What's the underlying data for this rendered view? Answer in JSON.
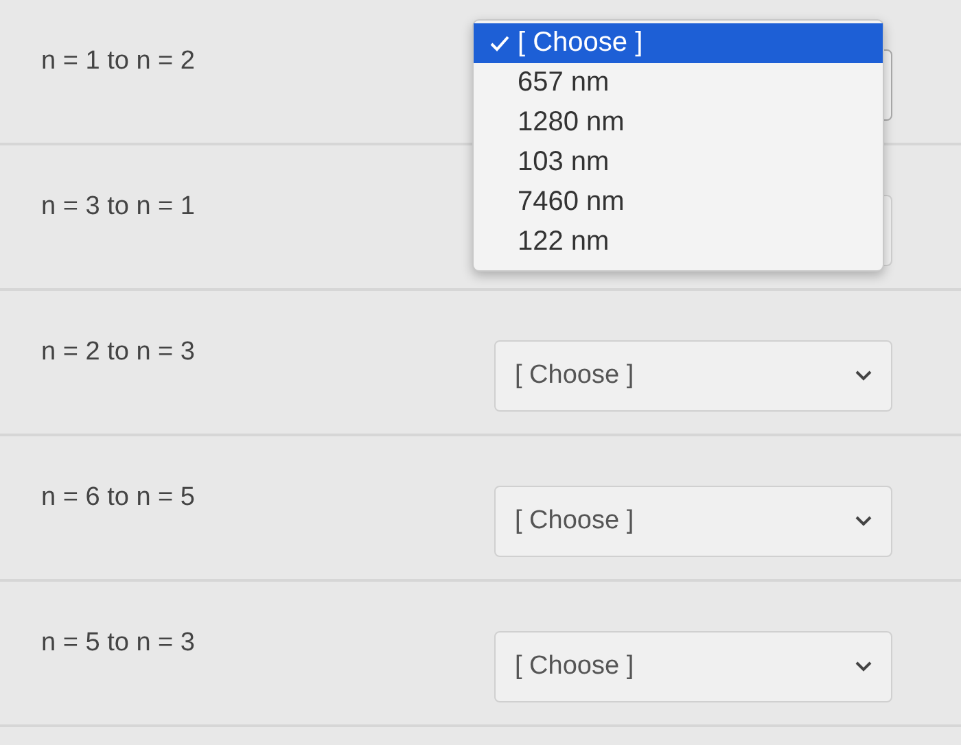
{
  "rows": [
    {
      "label": "n = 1 to n = 2",
      "select": {
        "open": true,
        "options": [
          {
            "label": "[ Choose ]",
            "selected": true
          },
          {
            "label": "657 nm",
            "selected": false
          },
          {
            "label": "1280 nm",
            "selected": false
          },
          {
            "label": "103 nm",
            "selected": false
          },
          {
            "label": "7460 nm",
            "selected": false
          },
          {
            "label": "122 nm",
            "selected": false
          }
        ]
      }
    },
    {
      "label": "n = 3 to n = 1",
      "select": {
        "open": false
      }
    },
    {
      "label": "n = 2 to n = 3",
      "select": {
        "open": false,
        "value": "[ Choose ]"
      }
    },
    {
      "label": "n = 6 to n = 5",
      "select": {
        "open": false,
        "value": "[ Choose ]"
      }
    },
    {
      "label": "n = 5 to n = 3",
      "select": {
        "open": false,
        "value": "[ Choose ]"
      }
    }
  ]
}
